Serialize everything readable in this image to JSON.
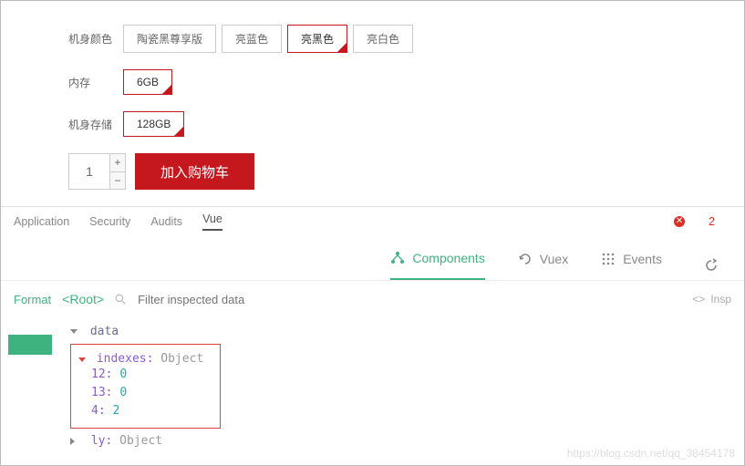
{
  "product": {
    "color_label": "机身颜色",
    "color_options": [
      "陶瓷黑尊享版",
      "亮蓝色",
      "亮黑色",
      "亮白色"
    ],
    "color_selected_index": 2,
    "mem_label": "内存",
    "mem_options": [
      "6GB"
    ],
    "mem_selected_index": 0,
    "storage_label": "机身存储",
    "storage_options": [
      "128GB"
    ],
    "storage_selected_index": 0,
    "qty_value": "1",
    "cart_label": "加入购物车"
  },
  "devtools": {
    "tabs": [
      "Application",
      "Security",
      "Audits",
      "Vue"
    ],
    "active_tab": "Vue",
    "error_count": "2"
  },
  "vuetabs": {
    "components": "Components",
    "vuex": "Vuex",
    "events": "Events"
  },
  "inspector": {
    "format_label": "Format",
    "root_label": "<Root>",
    "filter_placeholder": "Filter inspected data",
    "insp_label": "Insp"
  },
  "data_panel": {
    "header": "data",
    "indexes_label": "indexes",
    "obj_text": "Object",
    "rows": [
      {
        "k": "12",
        "v": "0"
      },
      {
        "k": "13",
        "v": "0"
      },
      {
        "k": "4",
        "v": "2"
      }
    ],
    "ly_label": "ly"
  },
  "watermark": "https://blog.csdn.net/qq_38454178"
}
